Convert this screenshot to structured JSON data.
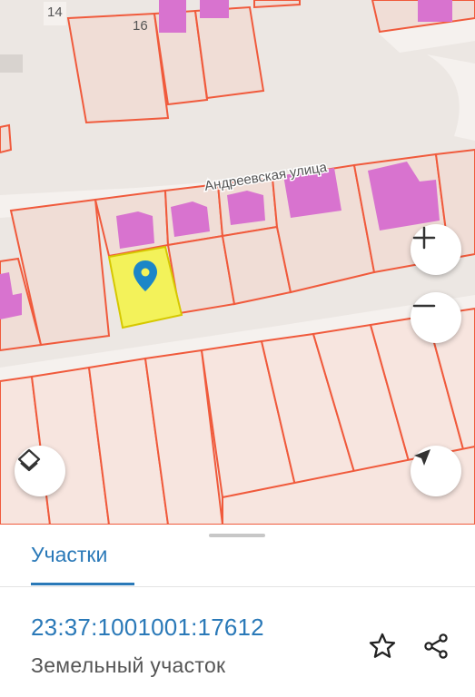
{
  "map": {
    "street_label": "Андреевская улица",
    "house_numbers": [
      "14",
      "16"
    ],
    "colors": {
      "background": "#ece7e3",
      "parcel_fill": "#f0ddd6",
      "parcel_stroke": "#f05a3c",
      "building": "#d873cf",
      "selected_parcel": "#f3f25a",
      "marker": "#1b86c7"
    },
    "controls": {
      "zoom_in": "plus-icon",
      "zoom_out": "minus-icon",
      "layers": "layers-icon",
      "locate": "navigation-arrow-icon"
    }
  },
  "sheet": {
    "tab_label": "Участки",
    "parcel": {
      "cadastral_number": "23:37:1001001:17612",
      "type": "Земельный участок"
    },
    "actions": {
      "favorite": "star-icon",
      "share": "share-icon"
    }
  }
}
